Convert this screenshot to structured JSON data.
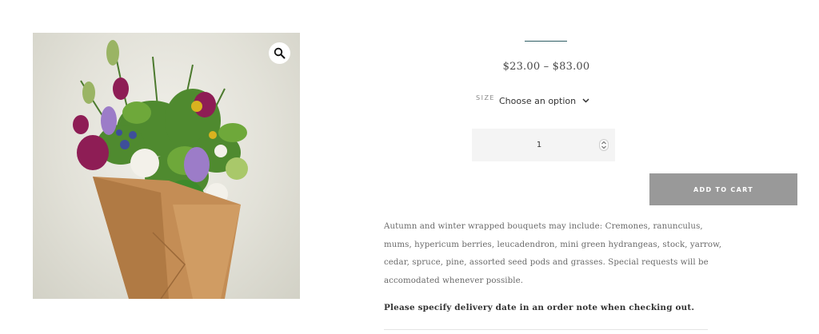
{
  "product": {
    "image_alt": "Wrapped bouquet of autumn and winter flowers",
    "price_range": "$23.00 – $83.00",
    "size_label": "SIZE",
    "size_selected": "Choose an option",
    "quantity": "1",
    "add_to_cart_label": "ADD TO CART",
    "description": "Autumn and winter wrapped bouquets may include: Cremones, ranunculus, mums, hypericum berries, leucadendron, mini green hydrangeas, stock, yarrow, cedar, spruce, pine, assorted seed pods and grasses. Special requests will be accomodated whenever possible.",
    "delivery_note": "Please specify delivery date in an order note when checking out."
  },
  "icons": {
    "zoom": "magnifier-icon",
    "size_dropdown": "chevron-down-icon",
    "quantity_spinner": "spinner-arrows-icon"
  },
  "colors": {
    "accent_rule": "#2f5d63",
    "button_bg": "#999999",
    "quantity_bg": "#f4f4f4"
  }
}
